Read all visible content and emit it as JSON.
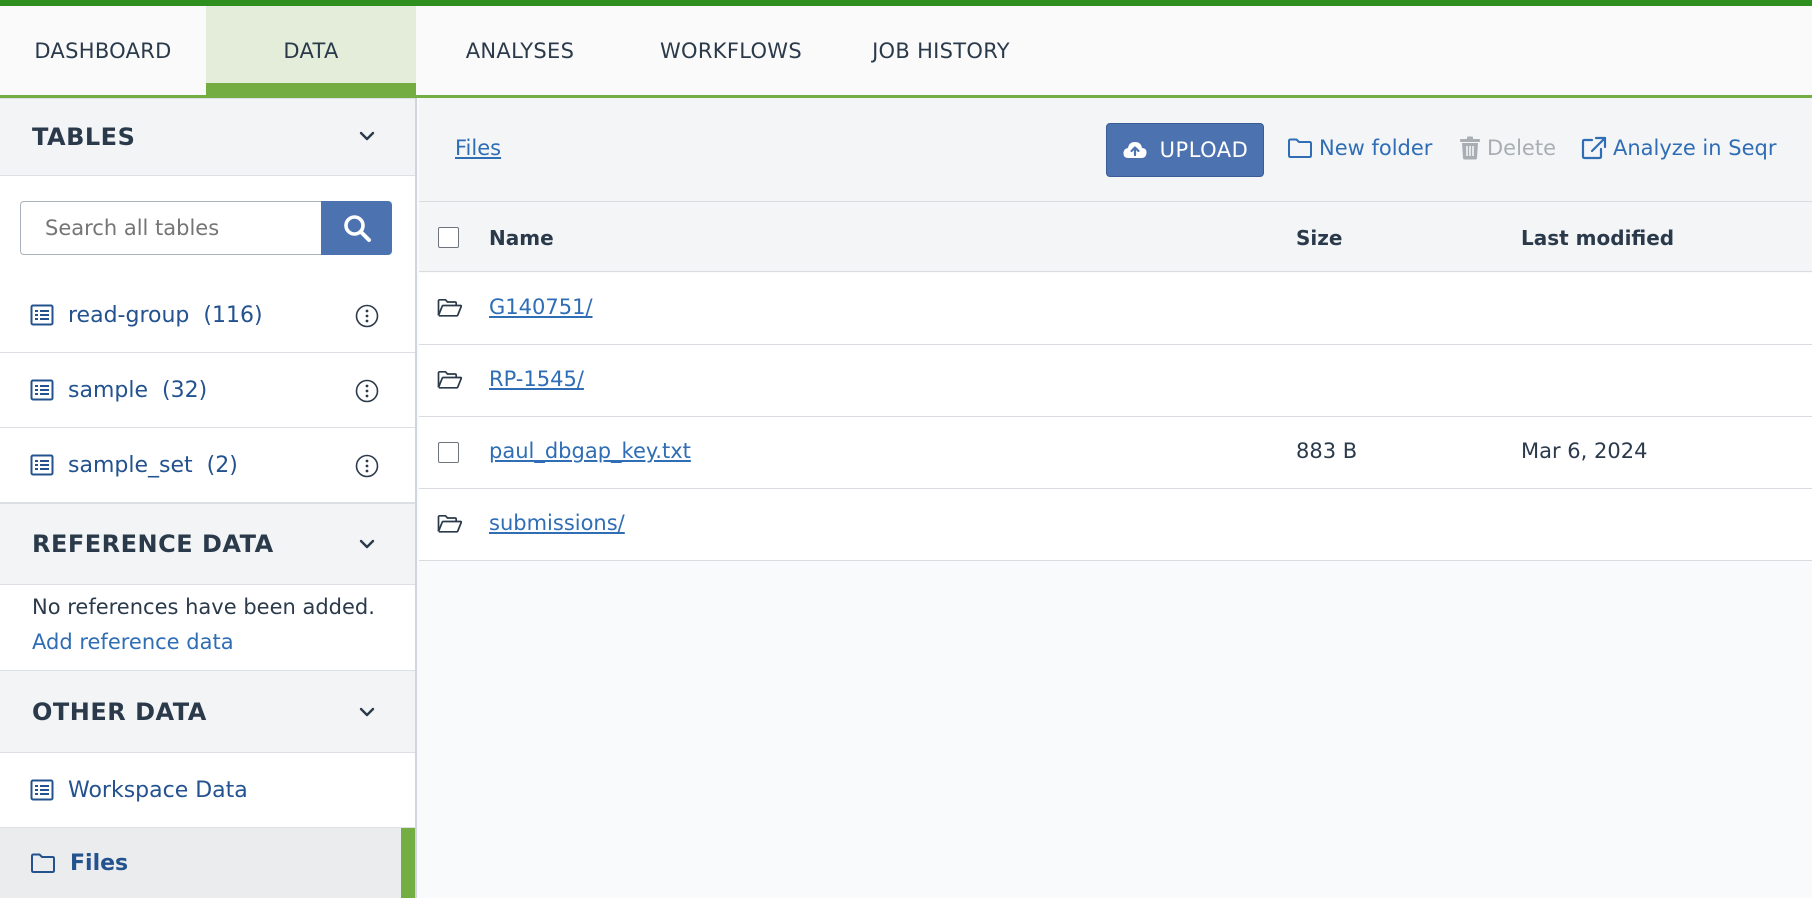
{
  "tabs": [
    {
      "label": "DASHBOARD"
    },
    {
      "label": "DATA",
      "active": true
    },
    {
      "label": "ANALYSES"
    },
    {
      "label": "WORKFLOWS"
    },
    {
      "label": "JOB HISTORY"
    }
  ],
  "sidebar": {
    "tables_header": "TABLES",
    "search_placeholder": "Search all tables",
    "tables": [
      {
        "label": "read-group",
        "count": "(116)"
      },
      {
        "label": "sample",
        "count": "(32)"
      },
      {
        "label": "sample_set",
        "count": "(2)"
      }
    ],
    "reference_header": "REFERENCE DATA",
    "reference_empty": "No references have been added.",
    "reference_add": "Add reference data",
    "other_header": "OTHER DATA",
    "other_items": [
      {
        "label": "Workspace Data"
      },
      {
        "label": "Files"
      }
    ]
  },
  "toolbar": {
    "breadcrumb": "Files",
    "upload_label": "UPLOAD",
    "new_folder_label": "New folder",
    "delete_label": "Delete",
    "analyze_label": "Analyze in Seqr"
  },
  "table": {
    "columns": [
      "Name",
      "Size",
      "Last modified"
    ],
    "rows": [
      {
        "type": "folder",
        "name": "G140751/",
        "size": "",
        "modified": ""
      },
      {
        "type": "folder",
        "name": "RP-1545/",
        "size": "",
        "modified": ""
      },
      {
        "type": "file",
        "name": "paul_dbgap_key.txt",
        "size": "883 B",
        "modified": "Mar 6, 2024"
      },
      {
        "type": "folder",
        "name": "submissions/",
        "size": "",
        "modified": ""
      }
    ]
  },
  "colors": {
    "accent_green": "#74ae43",
    "top_bar": "#2f8f1e",
    "primary_blue": "#4c72b0",
    "link_blue": "#2f6db5"
  }
}
